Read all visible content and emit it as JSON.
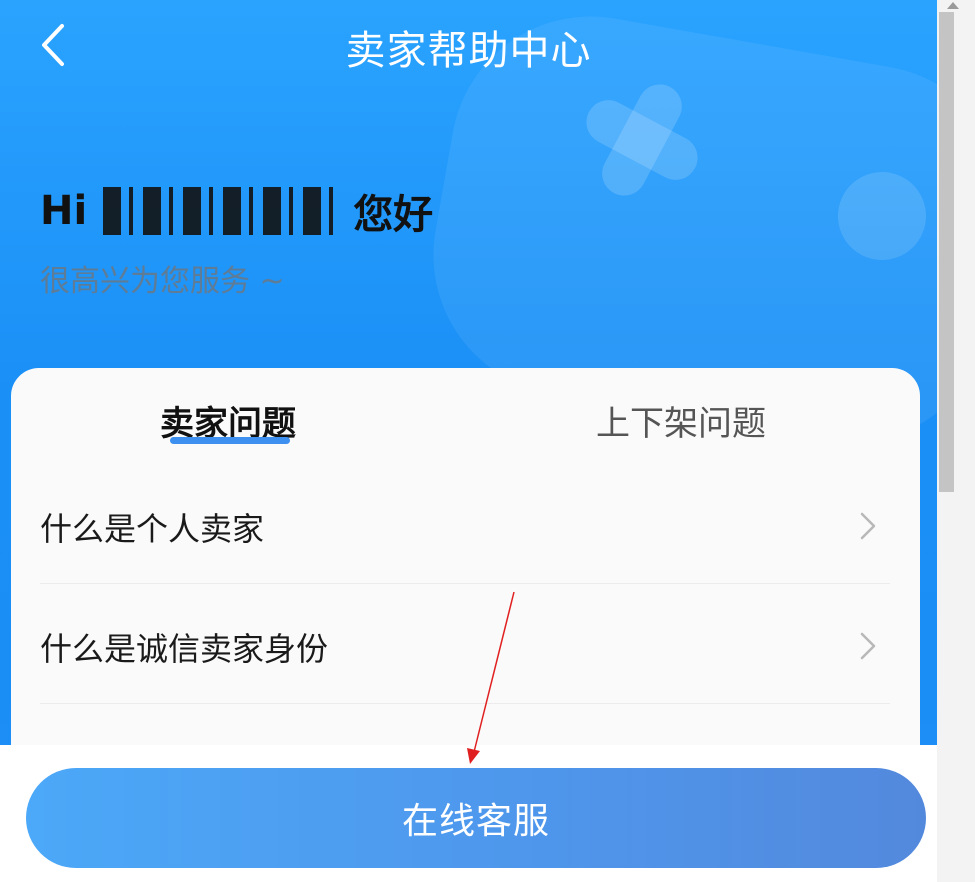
{
  "header": {
    "title": "卖家帮助中心",
    "back_icon": "chevron-left-icon"
  },
  "greeting": {
    "prefix": "Hi",
    "suffix": "您好",
    "sub": "很高兴为您服务 ~"
  },
  "tabs": [
    {
      "label": "卖家问题",
      "active": true
    },
    {
      "label": "上下架问题",
      "active": false
    }
  ],
  "faq_items": [
    {
      "label": "什么是个人卖家",
      "icon": "chevron-right-icon"
    },
    {
      "label": "什么是诚信卖家身份",
      "icon": "chevron-right-icon"
    }
  ],
  "cta": {
    "label": "在线客服"
  },
  "colors": {
    "brand_blue": "#1c8ef5",
    "tab_underline": "#3d8ff0",
    "annotation_arrow": "#e02020"
  }
}
